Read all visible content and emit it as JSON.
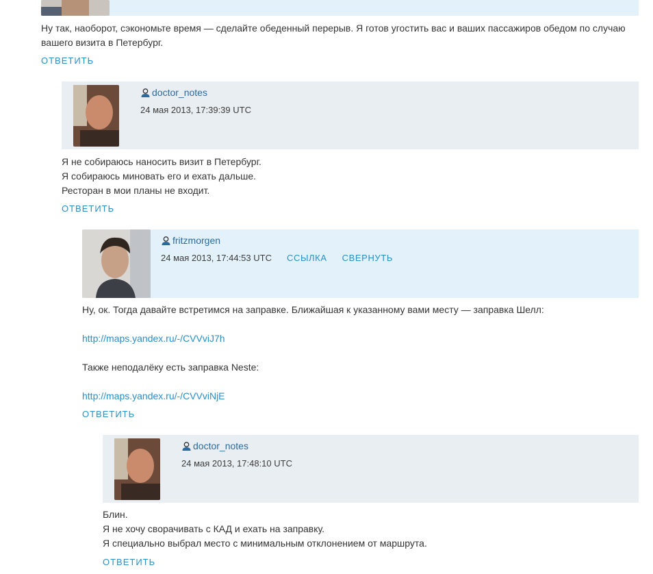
{
  "comments": [
    {
      "body": [
        "Ну так, наоборот, сэкономьте время — сделайте обеденный перерыв. Я готов угостить вас и ваших пассажиров обедом по случаю вашего визита в Петербург."
      ],
      "reply_label": "ОТВЕТИТЬ"
    },
    {
      "username": "doctor_notes",
      "timestamp": "24 мая 2013, 17:39:39 UTC",
      "body": [
        "Я не собираюсь наносить визит в Петербург.",
        "Я собираюсь миновать его и ехать дальше.",
        "Ресторан в мои планы не входит."
      ],
      "reply_label": "ОТВЕТИТЬ"
    },
    {
      "username": "fritzmorgen",
      "timestamp": "24 мая 2013, 17:44:53 UTC",
      "link_label": "ССЫЛКА",
      "collapse_label": "СВЕРНУТЬ",
      "body_line1": "Ну, ок. Тогда давайте встретимся на заправке. Ближайшая к указанному вами месту — заправка Шелл:",
      "url1": "http://maps.yandex.ru/-/CVVviJ7h",
      "body_line2": "Также неподалёку есть заправка Neste:",
      "url2": "http://maps.yandex.ru/-/CVVviNjE",
      "reply_label": "ОТВЕТИТЬ"
    },
    {
      "username": "doctor_notes",
      "timestamp": "24 мая 2013, 17:48:10 UTC",
      "body": [
        "Блин.",
        "Я не хочу сворачивать с КАД и ехать на заправку.",
        "Я специально выбрал место с минимальным отклонением от маршрута."
      ],
      "reply_label": "ОТВЕТИТЬ"
    }
  ],
  "colors": {
    "header_highlight": "#e3f2fa",
    "header_default": "#e9eef2",
    "link": "#2a8ec7",
    "username": "#2a6aa0"
  },
  "icons": [
    "user-icon"
  ]
}
